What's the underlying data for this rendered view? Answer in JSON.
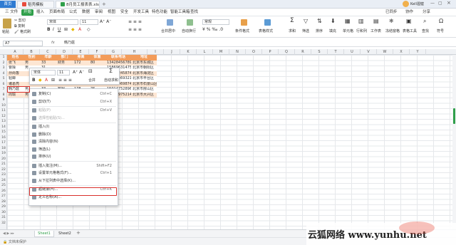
{
  "tabs": {
    "home": "首页",
    "template": "稻壳模板",
    "file": "8月员工报表表.xls"
  },
  "titlebar": {
    "user": "Kell渥健"
  },
  "menus": [
    "三 文件",
    "开始",
    "插入",
    "页面布局",
    "公式",
    "数据",
    "审阅",
    "视图",
    "安全",
    "开发工具",
    "特色功能",
    "智能工具箱",
    "查找"
  ],
  "menu_right": [
    "已同步",
    "协作",
    "分享"
  ],
  "ribbon": {
    "cut": "剪切",
    "paste": "粘贴",
    "copy": "复制",
    "format_painter": "格式刷",
    "font": "宋体",
    "size": "11",
    "merge_center": "合并居中",
    "wrap": "自动换行",
    "number_format": "常规",
    "cond_format": "条件格式",
    "table_style": "表格样式",
    "sum": "求和",
    "filter": "筛选",
    "sort": "排序",
    "fill": "填充",
    "cell": "单元格",
    "row_col": "行和列",
    "worksheet": "工作表",
    "freeze": "冻结窗格",
    "table_tools": "表格工具",
    "find": "查找",
    "symbol": "符号"
  },
  "formula_bar": {
    "cell_ref": "A7",
    "fx": "fx",
    "value": "韩乃庭"
  },
  "columns": [
    "A",
    "B",
    "C",
    "D",
    "E",
    "F",
    "G",
    "H",
    "I",
    "J",
    "K",
    "L",
    "M",
    "N",
    "O",
    "P",
    "Q",
    "R",
    "S",
    "T",
    "U",
    "V",
    "W",
    "X",
    "Y"
  ],
  "rows": [
    "1",
    "2",
    "3",
    "4",
    "5",
    "6",
    "7",
    "8",
    "9",
    "10",
    "11",
    "12",
    "13",
    "14",
    "15",
    "16",
    "17",
    "18",
    "19",
    "20",
    "21",
    "22",
    "23",
    "24",
    "25",
    "26",
    "27",
    "28",
    "29",
    "30",
    "31",
    "32"
  ],
  "table": {
    "headers": [
      "姓名",
      "性别",
      "年龄",
      "部门",
      "身高",
      "体重",
      "联系电话",
      "地址"
    ],
    "data": [
      [
        "张飞",
        "男",
        "33",
        "财务",
        "172",
        "80",
        "13428456789",
        "北京市东城区"
      ],
      [
        "曹操",
        "男",
        "31",
        "",
        "",
        "",
        "15869631475",
        "北京市朝阳区"
      ],
      [
        "孙尚香",
        "",
        "",
        "",
        "",
        "",
        "19963245874",
        "北京市海淀区"
      ],
      [
        "貂蝉",
        "",
        "",
        "",
        "",
        "",
        "13785469321",
        "北京市丰台区"
      ],
      [
        "诸葛亮",
        "",
        "",
        "",
        "",
        "",
        "13025469874",
        "北京市石景山区"
      ],
      [
        "韩乃庭",
        "男",
        "33",
        "客服",
        "178",
        "76",
        "15014752896",
        "北京市房山区"
      ],
      [
        "周瑜",
        "男",
        "24",
        "",
        "",
        "77",
        "15845975214",
        "北京市大兴区"
      ]
    ]
  },
  "mini_toolbar": {
    "font": "宋体",
    "size": "11",
    "bold": "B",
    "merge": "合并",
    "autosum": "自动求和"
  },
  "context_menu": [
    {
      "label": "复制(C)",
      "shortcut": "Ctrl+C",
      "disabled": false
    },
    {
      "label": "剪切(T)",
      "shortcut": "Ctrl+X",
      "disabled": false
    },
    {
      "label": "粘贴(P)",
      "shortcut": "Ctrl+V",
      "disabled": true
    },
    {
      "label": "选择性粘贴(S)...",
      "shortcut": "",
      "disabled": true
    },
    {
      "label": "插入(I)",
      "shortcut": "",
      "disabled": false
    },
    {
      "label": "删除(D)",
      "shortcut": "",
      "disabled": false
    },
    {
      "label": "清除内容(N)",
      "shortcut": "",
      "disabled": false
    },
    {
      "label": "筛选(L)",
      "shortcut": "",
      "disabled": false
    },
    {
      "label": "排序(U)",
      "shortcut": "",
      "disabled": false
    },
    {
      "label": "插入批注(M)...",
      "shortcut": "Shift+F2",
      "disabled": false
    },
    {
      "label": "设置单元格格式(F)...",
      "shortcut": "Ctrl+1",
      "disabled": false
    },
    {
      "label": "从下拉列表中选择(K)...",
      "shortcut": "",
      "disabled": false
    },
    {
      "label": "超链接(H)...",
      "shortcut": "Ctrl+K",
      "disabled": false
    },
    {
      "label": "定义名称(A)...",
      "shortcut": "",
      "disabled": false
    }
  ],
  "sheets": [
    "Sheet1",
    "Sheet2",
    "+"
  ],
  "status": {
    "left": "文档未保护"
  },
  "watermark": "云狐网络 www.yunhu.net",
  "colors": {
    "accent": "#2f9f4a",
    "header_fill": "#f39c5a",
    "odd_fill": "#fde6d3",
    "highlight": "#d9302c"
  }
}
